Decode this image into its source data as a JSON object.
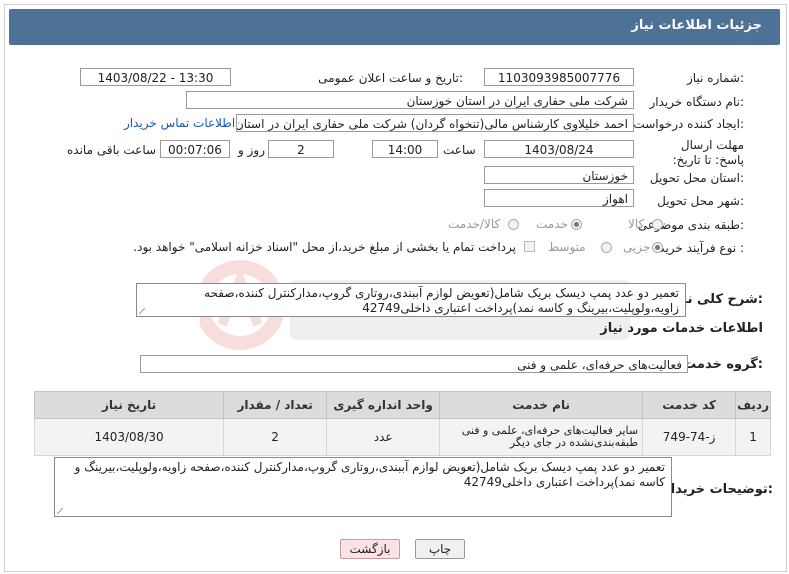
{
  "header": {
    "title": "جزئیات اطلاعات نیاز"
  },
  "fields": {
    "need_number_label": "شماره نیاز:",
    "need_number": "1103093985007776",
    "announce_label": "تاریخ و ساعت اعلان عمومی:",
    "announce_value": "1403/08/22 - 13:30",
    "buyer_org_label": "نام دستگاه خریدار:",
    "buyer_org": "شرکت ملی حفاری ایران در استان خوزستان",
    "creator_label": "ایجاد کننده درخواست:",
    "creator": "احمد خلیلاوی کارشناس مالی(تنخواه گردان) شرکت ملی حفاری ایران در استان",
    "contact_link": "اطلاعات تماس خریدار",
    "deadline_label": "مهلت ارسال پاسخ: تا تاریخ:",
    "deadline_date": "1403/08/24",
    "time_label": "ساعت",
    "deadline_time": "14:00",
    "days_value": "2",
    "days_label": "روز و",
    "remaining_time": "00:07:06",
    "remaining_label": "ساعت باقی مانده",
    "province_label": "استان محل تحویل:",
    "province": "خوزستان",
    "city_label": "شهر محل تحویل:",
    "city": "اهواز",
    "category_label": "طبقه بندی موضوعی:",
    "category_options": [
      "کالا",
      "خدمت",
      "کالا/خدمت"
    ],
    "process_label": "نوع فرآیند خرید :",
    "process_options": [
      "جزیی",
      "متوسط"
    ],
    "payment_note": "پرداخت تمام یا بخشی از مبلغ خرید،از محل \"اسناد خزانه اسلامی\" خواهد بود."
  },
  "summary": {
    "label": "شرح کلی نیاز:",
    "text": "تعمیر دو عدد پمپ دیسک بریک شامل(تعویض لوازم آببندی،روتاری گروپ،مدارکنترل کننده،صفحه زاویه،ولوپلیت،بیرینگ و کاسه نمد)پرداخت اعتباری داخلی42749"
  },
  "services_section": {
    "title": "اطلاعات خدمات مورد نیاز",
    "group_label": "گروه خدمت:",
    "group_value": "فعالیت‌های حرفه‌ای، علمی و فنی"
  },
  "table": {
    "headers": [
      "ردیف",
      "کد خدمت",
      "نام خدمت",
      "واحد اندازه گیری",
      "تعداد / مقدار",
      "تاریخ نیاز"
    ],
    "rows": [
      [
        "1",
        "ز-74-749",
        "سایر فعالیت‌های حرفه‌ای، علمی و فنی طبقه‌بندی‌نشده در جای دیگر",
        "عدد",
        "2",
        "1403/08/30"
      ]
    ]
  },
  "buyer_desc": {
    "label": "توضیحات خریدار:",
    "text": "تعمیر دو عدد پمپ دیسک بریک شامل(تعویض لوازم آببندی،روتاری گروپ،مدارکنترل کننده،صفحه زاویه،ولوپلیت،بیرینگ و کاسه نمد)پرداخت اعتباری داخلی42749"
  },
  "buttons": {
    "print": "چاپ",
    "back": "بازگشت"
  },
  "colors": {
    "header_bg": "#4e7198",
    "link": "#1a56b8",
    "back_btn": "#fbe3e3"
  }
}
